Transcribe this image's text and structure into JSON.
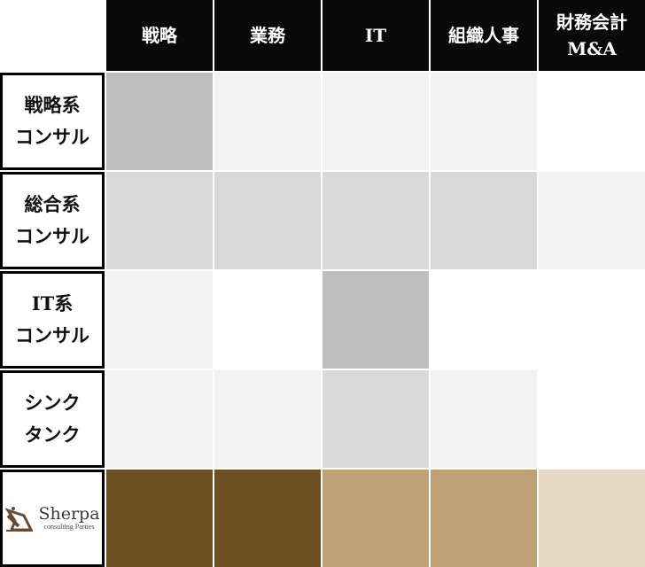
{
  "columns": [
    {
      "label": "戦略"
    },
    {
      "label": "業務"
    },
    {
      "label": "IT"
    },
    {
      "label": "組織人事"
    },
    {
      "label": "財務会計\nM&A"
    }
  ],
  "rows": [
    {
      "label": "戦略系\nコンサル",
      "cells": [
        "#bfbfbf",
        "#f1f1f1",
        "#f1f1f1",
        "#f1f1f1",
        "#ffffff"
      ]
    },
    {
      "label": "総合系\nコンサル",
      "cells": [
        "#d9d9d9",
        "#d9d9d9",
        "#d9d9d9",
        "#d9d9d9",
        "#f1f1f1"
      ]
    },
    {
      "label": "IT系\nコンサル",
      "cells": [
        "#f1f1f1",
        "#ffffff",
        "#bfbfbf",
        "#ffffff",
        "#ffffff"
      ]
    },
    {
      "label": "シンク\nタンク",
      "cells": [
        "#f1f1f1",
        "#f1f1f1",
        "#d9d9d9",
        "#f1f1f1",
        "#ffffff"
      ]
    },
    {
      "label": "",
      "logo": {
        "name": "Sherpa",
        "tagline": "consulting Parties"
      },
      "cells": [
        "#6c5021",
        "#6c5021",
        "#bea275",
        "#bea275",
        "#e7d8c3"
      ]
    }
  ],
  "colors": {
    "header_bg": "#0a0a0a",
    "logo_brown": "#6b4a33"
  }
}
